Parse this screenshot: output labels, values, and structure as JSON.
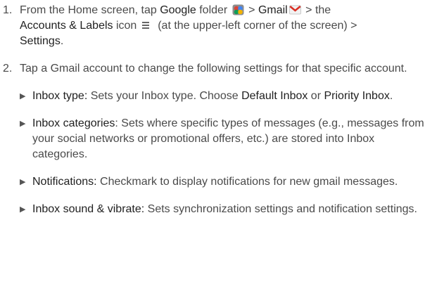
{
  "step1": {
    "number": "1.",
    "t1": "From the Home screen, tap ",
    "google_folder": "Google",
    "t2": " folder ",
    "t3": " > ",
    "gmail": "Gmail",
    "t4": " > the",
    "accounts_labels": "Accounts & Labels",
    "t5": " icon ",
    "t6": " (at the upper-left corner of the screen) >",
    "settings": "Settings",
    "t7": "."
  },
  "step2": {
    "number": "2.",
    "text": "Tap a Gmail account to change the following settings for that specific account."
  },
  "bullets": [
    {
      "term": "Inbox type:",
      "pre": " Sets your Inbox type. Choose ",
      "opt1": "Default Inbox",
      "mid": " or ",
      "opt2": "Priority Inbox",
      "end": "."
    },
    {
      "term": "Inbox categories",
      "text": ": Sets where specific types of messages (e.g., messages from your social networks or promotional offers, etc.) are stored into Inbox categories."
    },
    {
      "term": "Notifications:",
      "text": " Checkmark to display notifications for new gmail messages."
    },
    {
      "term": "Inbox sound & vibrate:",
      "text": " Sets synchronization settings and notification settings."
    }
  ],
  "bullet_glyph": "▶",
  "icons": [
    "google-folder-icon",
    "gmail-icon",
    "menu-icon"
  ],
  "colors": {
    "text": "#4a4a4a",
    "emphasis": "#1f1f1f"
  }
}
